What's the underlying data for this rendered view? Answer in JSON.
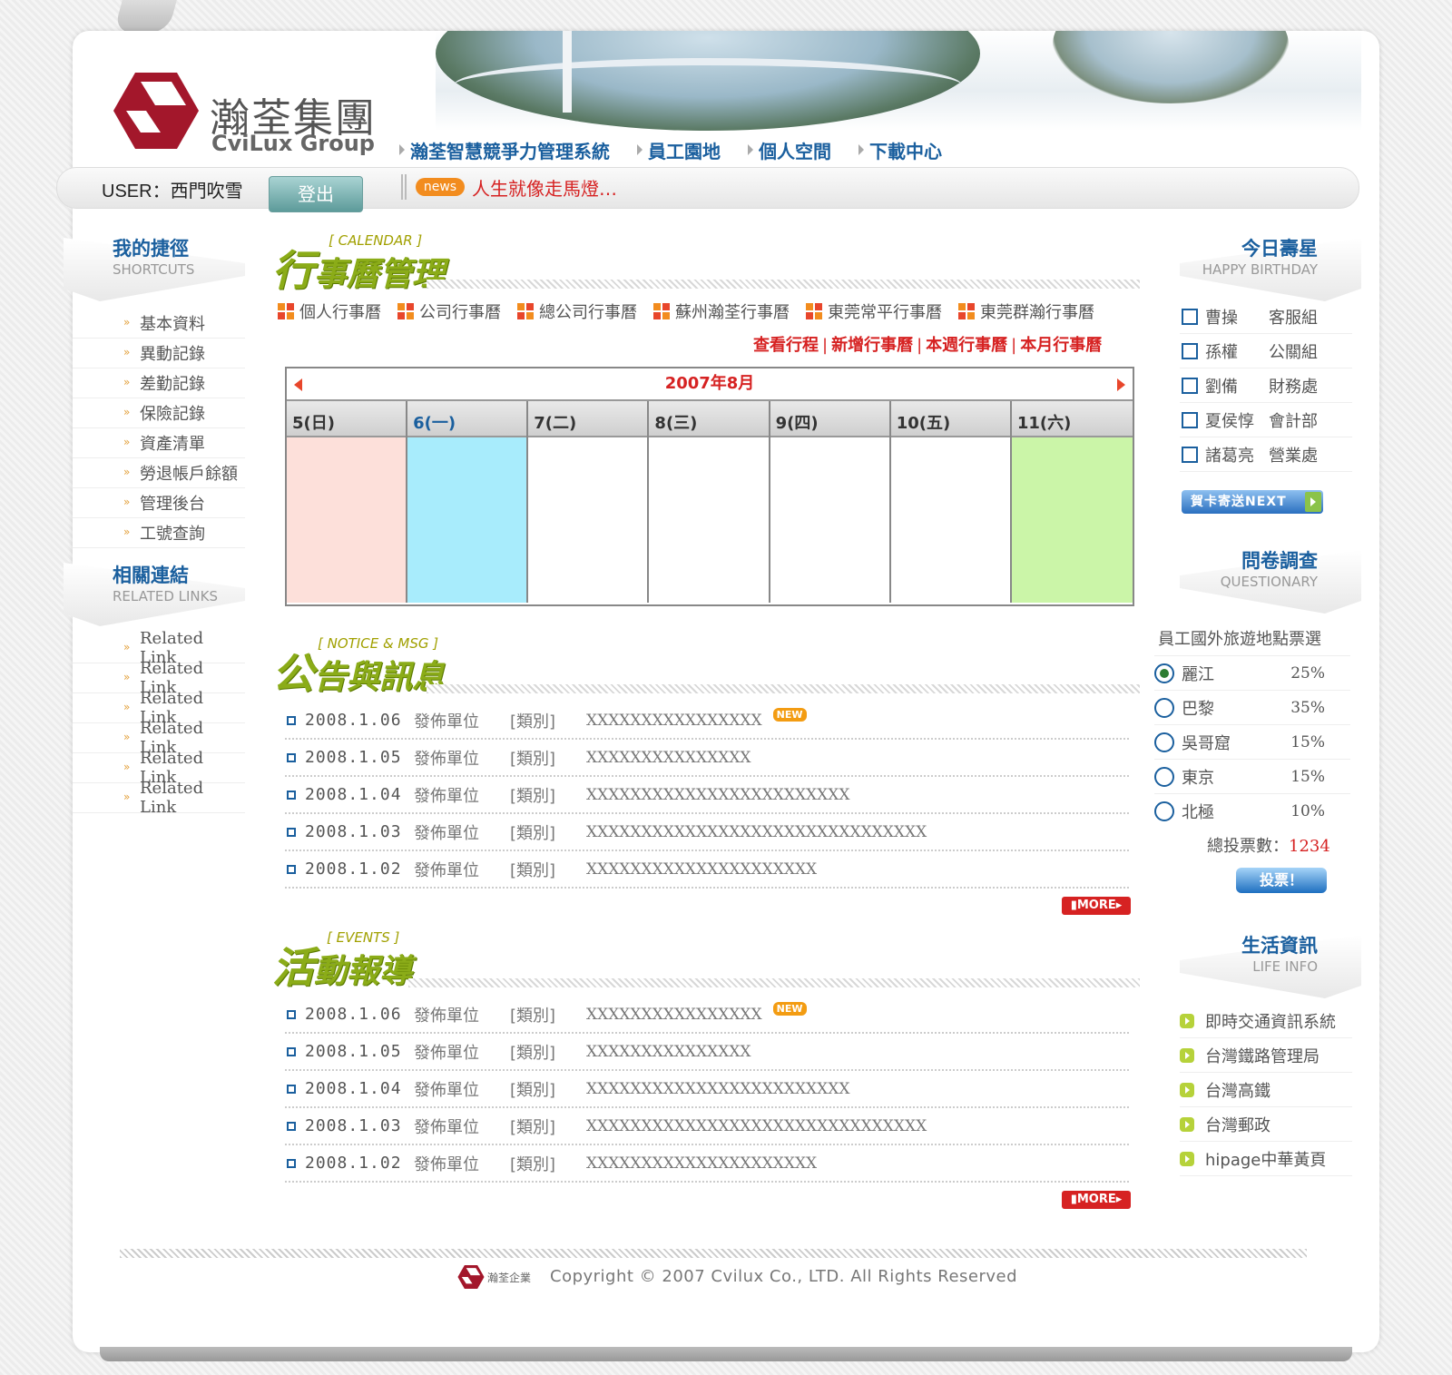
{
  "brand": {
    "name_cn": "瀚荃集團",
    "name_en": "CviLux Group"
  },
  "nav": [
    "瀚荃智慧競爭力管理系統",
    "員工園地",
    "個人空間",
    "下載中心"
  ],
  "user": {
    "label": "USER：",
    "name": "西門吹雪",
    "logout": "登出"
  },
  "news": {
    "badge": "news",
    "text": "人生就像走馬燈…"
  },
  "shortcuts": {
    "title": "我的捷徑",
    "subtitle": "SHORTCUTS",
    "items": [
      "基本資料",
      "異動記錄",
      "差勤記錄",
      "保險記錄",
      "資產清單",
      "勞退帳戶餘額",
      "管理後台",
      "工號查詢"
    ]
  },
  "related": {
    "title": "相關連結",
    "subtitle": "RELATED LINKS",
    "items": [
      "Related Link",
      "Related Link",
      "Related Link",
      "Related Link",
      "Related Link",
      "Related Link"
    ]
  },
  "calendar": {
    "en": "[ CALENDAR ]",
    "title_first": "行",
    "title_rest": "事曆管理",
    "tabs": [
      "個人行事曆",
      "公司行事曆",
      "總公司行事曆",
      "蘇州瀚荃行事曆",
      "東莞常平行事曆",
      "東莞群瀚行事曆"
    ],
    "actions": [
      "查看行程",
      "新增行事曆",
      "本週行事曆",
      "本月行事曆"
    ],
    "month": "2007年8月",
    "days": [
      {
        "label": "5(日)",
        "color": "#fde0da"
      },
      {
        "label": "6(一)",
        "color": "#a8ecfc"
      },
      {
        "label": "7(二)",
        "color": "#ffffff"
      },
      {
        "label": "8(三)",
        "color": "#ffffff"
      },
      {
        "label": "9(四)",
        "color": "#ffffff"
      },
      {
        "label": "10(五)",
        "color": "#ffffff"
      },
      {
        "label": "11(六)",
        "color": "#cbf5a8"
      }
    ]
  },
  "notice": {
    "en": "[ NOTICE & MSG ]",
    "title_first": "公",
    "title_rest": "告與訊息",
    "rows": [
      {
        "date": "2008.1.06",
        "unit": "發佈單位",
        "cat": "[類別]",
        "subject": "XXXXXXXXXXXXXXXX",
        "new": "NEW"
      },
      {
        "date": "2008.1.05",
        "unit": "發佈單位",
        "cat": "[類別]",
        "subject": "XXXXXXXXXXXXXXX",
        "new": ""
      },
      {
        "date": "2008.1.04",
        "unit": "發佈單位",
        "cat": "[類別]",
        "subject": "XXXXXXXXXXXXXXXXXXXXXXXX",
        "new": ""
      },
      {
        "date": "2008.1.03",
        "unit": "發佈單位",
        "cat": "[類別]",
        "subject": "XXXXXXXXXXXXXXXXXXXXXXXXXXXXXXX",
        "new": ""
      },
      {
        "date": "2008.1.02",
        "unit": "發佈單位",
        "cat": "[類別]",
        "subject": "XXXXXXXXXXXXXXXXXXXXX",
        "new": ""
      }
    ],
    "more": "MORE"
  },
  "events": {
    "en": "[ EVENTS ]",
    "title_first": "活",
    "title_rest": "動報導",
    "rows": [
      {
        "date": "2008.1.06",
        "unit": "發佈單位",
        "cat": "[類別]",
        "subject": "XXXXXXXXXXXXXXXX",
        "new": "NEW"
      },
      {
        "date": "2008.1.05",
        "unit": "發佈單位",
        "cat": "[類別]",
        "subject": "XXXXXXXXXXXXXXX",
        "new": ""
      },
      {
        "date": "2008.1.04",
        "unit": "發佈單位",
        "cat": "[類別]",
        "subject": "XXXXXXXXXXXXXXXXXXXXXXXX",
        "new": ""
      },
      {
        "date": "2008.1.03",
        "unit": "發佈單位",
        "cat": "[類別]",
        "subject": "XXXXXXXXXXXXXXXXXXXXXXXXXXXXXXX",
        "new": ""
      },
      {
        "date": "2008.1.02",
        "unit": "發佈單位",
        "cat": "[類別]",
        "subject": "XXXXXXXXXXXXXXXXXXXXX",
        "new": ""
      }
    ],
    "more": "MORE"
  },
  "birthday": {
    "title": "今日壽星",
    "subtitle": "HAPPY BIRTHDAY",
    "people": [
      {
        "name": "曹操",
        "dept": "客服組"
      },
      {
        "name": "孫權",
        "dept": "公關組"
      },
      {
        "name": "劉備",
        "dept": "財務處"
      },
      {
        "name": "夏侯惇",
        "dept": "會計部"
      },
      {
        "name": "諸葛亮",
        "dept": "營業處"
      }
    ],
    "card_button": "賀卡寄送NEXT"
  },
  "survey": {
    "title": "問卷調查",
    "subtitle": "QUESTIONARY",
    "question": "員工國外旅遊地點票選",
    "options": [
      {
        "label": "麗江",
        "pct": "25%",
        "selected": true
      },
      {
        "label": "巴黎",
        "pct": "35%",
        "selected": false
      },
      {
        "label": "吳哥窟",
        "pct": "15%",
        "selected": false
      },
      {
        "label": "東京",
        "pct": "15%",
        "selected": false
      },
      {
        "label": "北極",
        "pct": "10%",
        "selected": false
      }
    ],
    "total_label": "總投票數：",
    "total": "1234",
    "vote_button": "投票！"
  },
  "life": {
    "title": "生活資訊",
    "subtitle": "LIFE INFO",
    "items": [
      "即時交通資訊系統",
      "台灣鐵路管理局",
      "台灣高鐵",
      "台灣郵政",
      "hipage中華黃頁"
    ]
  },
  "footer": {
    "logo_text": "瀚荃企業",
    "copyright": "Copyright © 2007 Cvilux Co., LTD. All Rights Reserved"
  }
}
